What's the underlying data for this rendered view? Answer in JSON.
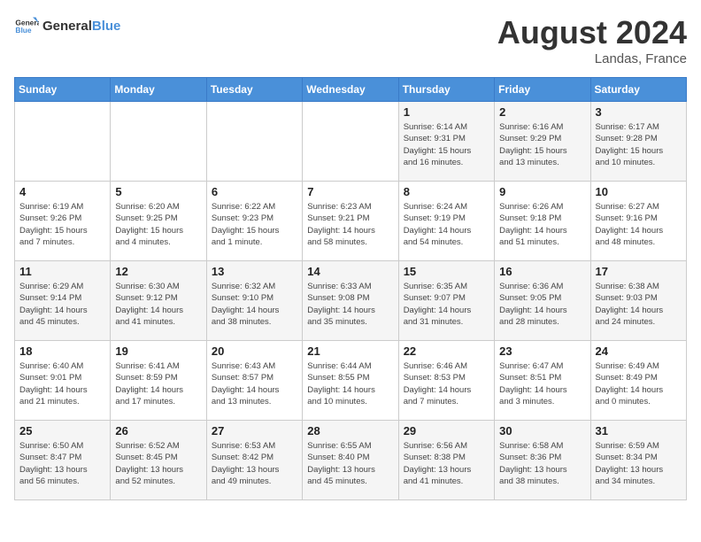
{
  "header": {
    "logo_general": "General",
    "logo_blue": "Blue",
    "title": "August 2024",
    "subtitle": "Landas, France"
  },
  "days_of_week": [
    "Sunday",
    "Monday",
    "Tuesday",
    "Wednesday",
    "Thursday",
    "Friday",
    "Saturday"
  ],
  "weeks": [
    [
      {
        "day": "",
        "info": ""
      },
      {
        "day": "",
        "info": ""
      },
      {
        "day": "",
        "info": ""
      },
      {
        "day": "",
        "info": ""
      },
      {
        "day": "1",
        "info": "Sunrise: 6:14 AM\nSunset: 9:31 PM\nDaylight: 15 hours\nand 16 minutes."
      },
      {
        "day": "2",
        "info": "Sunrise: 6:16 AM\nSunset: 9:29 PM\nDaylight: 15 hours\nand 13 minutes."
      },
      {
        "day": "3",
        "info": "Sunrise: 6:17 AM\nSunset: 9:28 PM\nDaylight: 15 hours\nand 10 minutes."
      }
    ],
    [
      {
        "day": "4",
        "info": "Sunrise: 6:19 AM\nSunset: 9:26 PM\nDaylight: 15 hours\nand 7 minutes."
      },
      {
        "day": "5",
        "info": "Sunrise: 6:20 AM\nSunset: 9:25 PM\nDaylight: 15 hours\nand 4 minutes."
      },
      {
        "day": "6",
        "info": "Sunrise: 6:22 AM\nSunset: 9:23 PM\nDaylight: 15 hours\nand 1 minute."
      },
      {
        "day": "7",
        "info": "Sunrise: 6:23 AM\nSunset: 9:21 PM\nDaylight: 14 hours\nand 58 minutes."
      },
      {
        "day": "8",
        "info": "Sunrise: 6:24 AM\nSunset: 9:19 PM\nDaylight: 14 hours\nand 54 minutes."
      },
      {
        "day": "9",
        "info": "Sunrise: 6:26 AM\nSunset: 9:18 PM\nDaylight: 14 hours\nand 51 minutes."
      },
      {
        "day": "10",
        "info": "Sunrise: 6:27 AM\nSunset: 9:16 PM\nDaylight: 14 hours\nand 48 minutes."
      }
    ],
    [
      {
        "day": "11",
        "info": "Sunrise: 6:29 AM\nSunset: 9:14 PM\nDaylight: 14 hours\nand 45 minutes."
      },
      {
        "day": "12",
        "info": "Sunrise: 6:30 AM\nSunset: 9:12 PM\nDaylight: 14 hours\nand 41 minutes."
      },
      {
        "day": "13",
        "info": "Sunrise: 6:32 AM\nSunset: 9:10 PM\nDaylight: 14 hours\nand 38 minutes."
      },
      {
        "day": "14",
        "info": "Sunrise: 6:33 AM\nSunset: 9:08 PM\nDaylight: 14 hours\nand 35 minutes."
      },
      {
        "day": "15",
        "info": "Sunrise: 6:35 AM\nSunset: 9:07 PM\nDaylight: 14 hours\nand 31 minutes."
      },
      {
        "day": "16",
        "info": "Sunrise: 6:36 AM\nSunset: 9:05 PM\nDaylight: 14 hours\nand 28 minutes."
      },
      {
        "day": "17",
        "info": "Sunrise: 6:38 AM\nSunset: 9:03 PM\nDaylight: 14 hours\nand 24 minutes."
      }
    ],
    [
      {
        "day": "18",
        "info": "Sunrise: 6:40 AM\nSunset: 9:01 PM\nDaylight: 14 hours\nand 21 minutes."
      },
      {
        "day": "19",
        "info": "Sunrise: 6:41 AM\nSunset: 8:59 PM\nDaylight: 14 hours\nand 17 minutes."
      },
      {
        "day": "20",
        "info": "Sunrise: 6:43 AM\nSunset: 8:57 PM\nDaylight: 14 hours\nand 13 minutes."
      },
      {
        "day": "21",
        "info": "Sunrise: 6:44 AM\nSunset: 8:55 PM\nDaylight: 14 hours\nand 10 minutes."
      },
      {
        "day": "22",
        "info": "Sunrise: 6:46 AM\nSunset: 8:53 PM\nDaylight: 14 hours\nand 7 minutes."
      },
      {
        "day": "23",
        "info": "Sunrise: 6:47 AM\nSunset: 8:51 PM\nDaylight: 14 hours\nand 3 minutes."
      },
      {
        "day": "24",
        "info": "Sunrise: 6:49 AM\nSunset: 8:49 PM\nDaylight: 14 hours\nand 0 minutes."
      }
    ],
    [
      {
        "day": "25",
        "info": "Sunrise: 6:50 AM\nSunset: 8:47 PM\nDaylight: 13 hours\nand 56 minutes."
      },
      {
        "day": "26",
        "info": "Sunrise: 6:52 AM\nSunset: 8:45 PM\nDaylight: 13 hours\nand 52 minutes."
      },
      {
        "day": "27",
        "info": "Sunrise: 6:53 AM\nSunset: 8:42 PM\nDaylight: 13 hours\nand 49 minutes."
      },
      {
        "day": "28",
        "info": "Sunrise: 6:55 AM\nSunset: 8:40 PM\nDaylight: 13 hours\nand 45 minutes."
      },
      {
        "day": "29",
        "info": "Sunrise: 6:56 AM\nSunset: 8:38 PM\nDaylight: 13 hours\nand 41 minutes."
      },
      {
        "day": "30",
        "info": "Sunrise: 6:58 AM\nSunset: 8:36 PM\nDaylight: 13 hours\nand 38 minutes."
      },
      {
        "day": "31",
        "info": "Sunrise: 6:59 AM\nSunset: 8:34 PM\nDaylight: 13 hours\nand 34 minutes."
      }
    ]
  ]
}
